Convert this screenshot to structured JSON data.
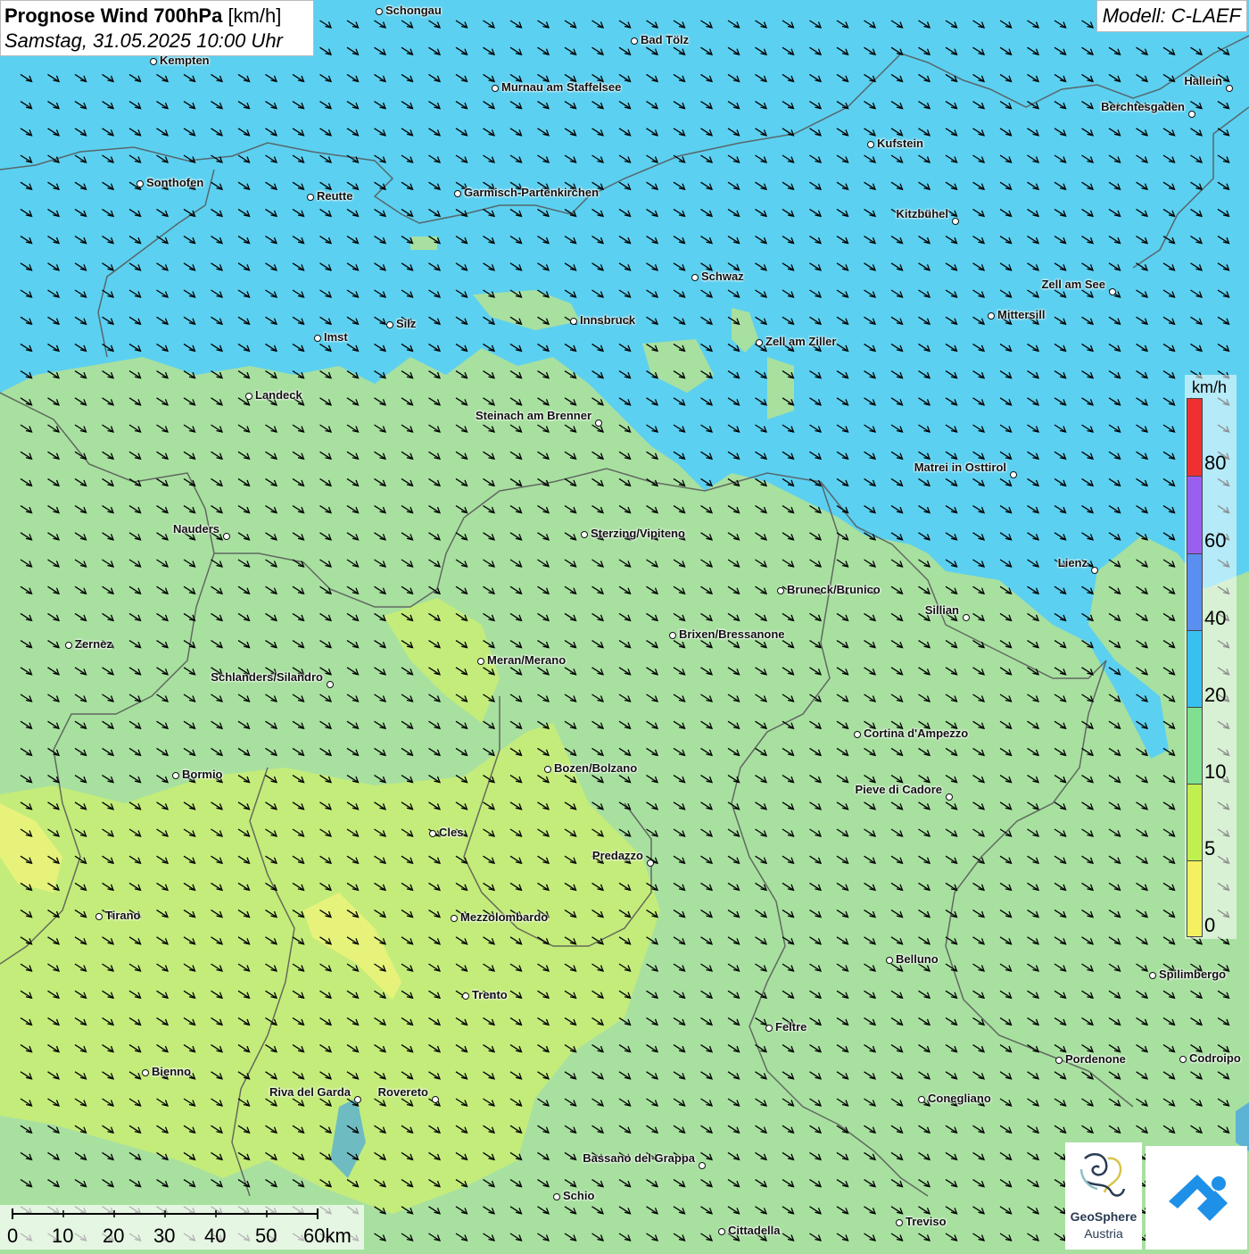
{
  "header": {
    "title_bold": "Prognose Wind 700hPa",
    "title_unit": "[km/h]",
    "datetime": "Samstag, 31.05.2025 10:00 Uhr",
    "model": "Modell: C-LAEF"
  },
  "legend": {
    "unit": "km/h",
    "labels": [
      "80",
      "60",
      "40",
      "20",
      "10",
      "5",
      "0"
    ],
    "colors": [
      "#f03030",
      "#9a5ef0",
      "#5a8ef0",
      "#38c0f0",
      "#80e090",
      "#c0f050",
      "#f4f060"
    ]
  },
  "scale": {
    "labels": [
      "0",
      "10",
      "20",
      "30",
      "40",
      "50",
      "60km"
    ]
  },
  "logos": {
    "geosphere_line1": "GeoSphere",
    "geosphere_line2": "Austria"
  },
  "colors": {
    "calm": "#f4f060",
    "light": "#c0f050",
    "moderate": "#a8e0a0",
    "fresh": "#5cd0f0",
    "strong": "#5a8ef0",
    "border": "#555555",
    "water": "#4aa8e0"
  },
  "wind": {
    "direction": "from north-west",
    "arrow_color": "#000000"
  },
  "cities": [
    {
      "name": "Schongau"
    },
    {
      "name": "Bad Tölz"
    },
    {
      "name": "Kempten"
    },
    {
      "name": "Murnau am Staffelsee"
    },
    {
      "name": "Hallein"
    },
    {
      "name": "Berchtesgaden"
    },
    {
      "name": "Kufstein"
    },
    {
      "name": "Sonthofen"
    },
    {
      "name": "Reutte"
    },
    {
      "name": "Garmisch-Partenkirchen"
    },
    {
      "name": "Kitzbühel"
    },
    {
      "name": "Schwaz"
    },
    {
      "name": "Zell am See"
    },
    {
      "name": "Innsbruck"
    },
    {
      "name": "Mittersill"
    },
    {
      "name": "Silz"
    },
    {
      "name": "Imst"
    },
    {
      "name": "Zell am Ziller"
    },
    {
      "name": "Landeck"
    },
    {
      "name": "Steinach am Brenner"
    },
    {
      "name": "Matrei in Osttirol"
    },
    {
      "name": "Nauders"
    },
    {
      "name": "Sterzing/Vipiteno"
    },
    {
      "name": "Lienz"
    },
    {
      "name": "Bruneck/Brunico"
    },
    {
      "name": "Sillian"
    },
    {
      "name": "Zernez"
    },
    {
      "name": "Brixen/Bressanone"
    },
    {
      "name": "Meran/Merano"
    },
    {
      "name": "Schlanders/Silandro"
    },
    {
      "name": "Cortina d'Ampezzo"
    },
    {
      "name": "Bormio"
    },
    {
      "name": "Bozen/Bolzano"
    },
    {
      "name": "Pieve di Cadore"
    },
    {
      "name": "Cles"
    },
    {
      "name": "Predazzo"
    },
    {
      "name": "Tirano"
    },
    {
      "name": "Mezzolombardo"
    },
    {
      "name": "Belluno"
    },
    {
      "name": "Spilimbergo"
    },
    {
      "name": "Trento"
    },
    {
      "name": "Feltre"
    },
    {
      "name": "Pordenone"
    },
    {
      "name": "Codroipo"
    },
    {
      "name": "Bienno"
    },
    {
      "name": "Riva del Garda"
    },
    {
      "name": "Rovereto"
    },
    {
      "name": "Conegliano"
    },
    {
      "name": "Bassano del Grappa"
    },
    {
      "name": "Schio"
    },
    {
      "name": "Treviso"
    },
    {
      "name": "Cittadella"
    }
  ]
}
